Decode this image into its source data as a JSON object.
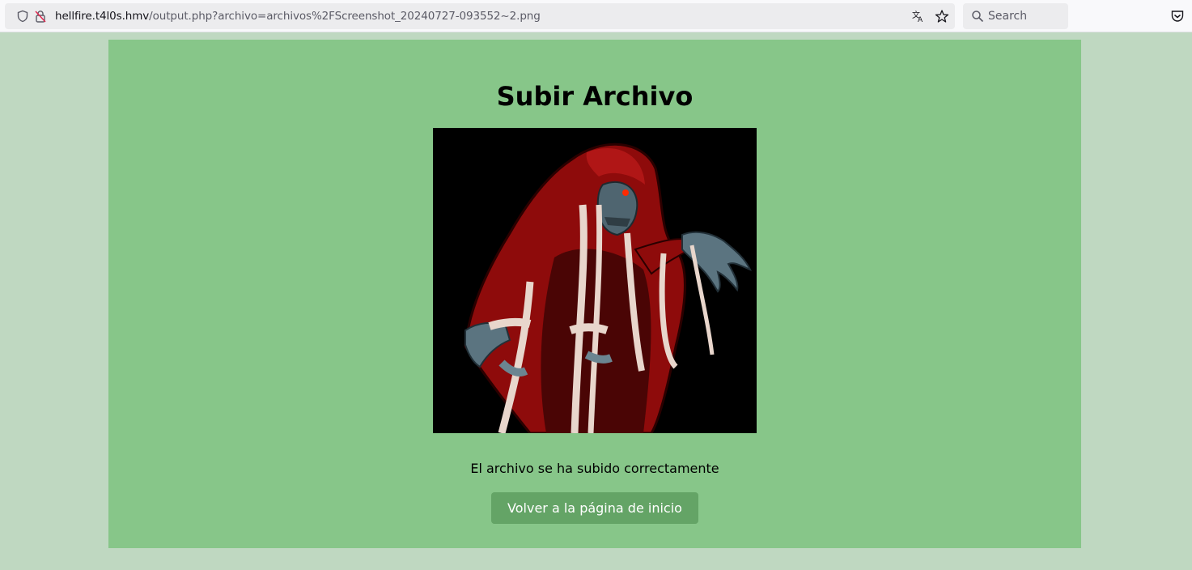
{
  "browser": {
    "url_host": "hellfire.t4l0s.hmv",
    "url_path": "/output.php?archivo=archivos%2FScreenshot_20240727-093552~2.png",
    "search_placeholder": "Search"
  },
  "page": {
    "title": "Subir Archivo",
    "message": "El archivo se ha subido correctamente",
    "back_button_label": "Volver a la página de inicio"
  },
  "colors": {
    "page_background": "#bfd8c1",
    "panel_background": "#87c689",
    "button_background": "#64a466"
  }
}
